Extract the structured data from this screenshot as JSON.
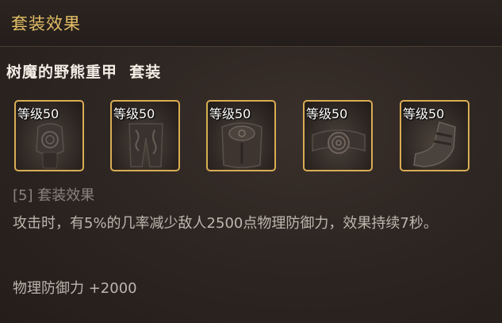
{
  "header": {
    "title": "套装效果"
  },
  "set": {
    "name": "树魔的野熊重甲  套装"
  },
  "pieces": [
    {
      "level_label": "等级50",
      "icon": "gauntlet-icon"
    },
    {
      "level_label": "等级50",
      "icon": "leg-armor-icon"
    },
    {
      "level_label": "等级50",
      "icon": "chest-armor-icon"
    },
    {
      "level_label": "等级50",
      "icon": "belt-icon"
    },
    {
      "level_label": "等级50",
      "icon": "boot-icon"
    }
  ],
  "effect": {
    "title": "[5] 套装效果",
    "description": "攻击时，有5%的几率减少敌人2500点物理防御力，效果持续7秒。",
    "stat": "物理防御力 +2000"
  },
  "colors": {
    "header_title": "#e3be66",
    "slot_border": "#d9ad55",
    "set_name": "#f2ece4",
    "effect_title": "#8a847d",
    "effect_text": "#bdb6ad"
  }
}
